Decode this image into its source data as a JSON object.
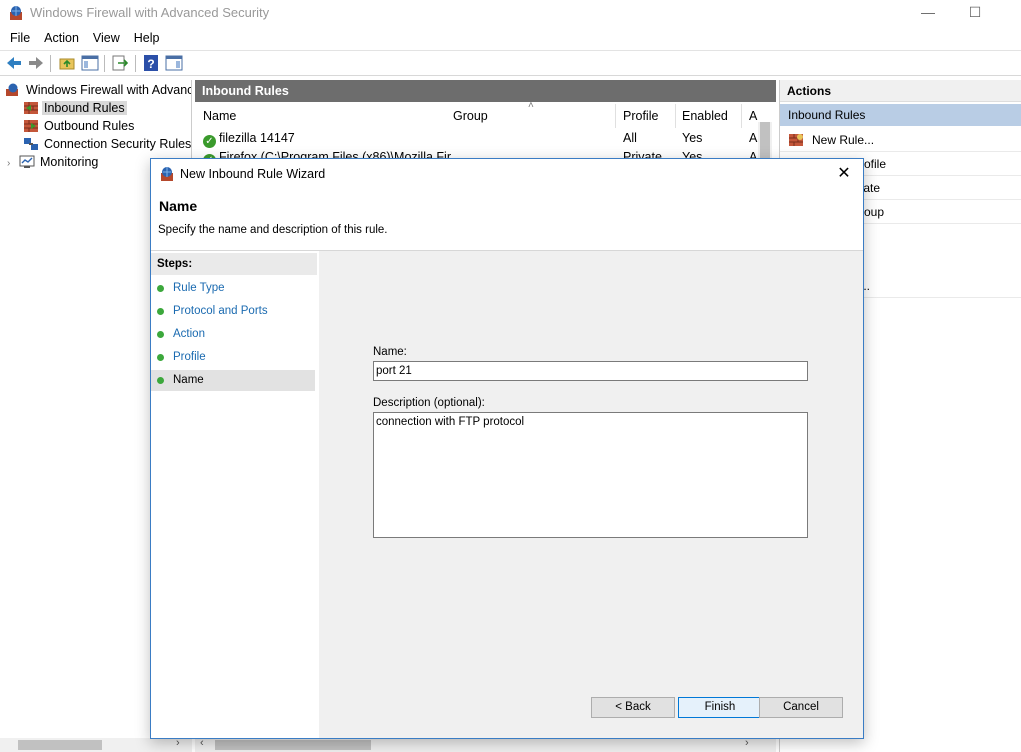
{
  "window": {
    "title": "Windows Firewall with Advanced Security",
    "controls": [
      "—",
      "☐",
      "✕"
    ]
  },
  "menu": [
    "File",
    "Action",
    "View",
    "Help"
  ],
  "tree": {
    "root": "Windows Firewall with Advance",
    "items": [
      "Inbound Rules",
      "Outbound Rules",
      "Connection Security Rules",
      "Monitoring"
    ],
    "selected": "Inbound Rules"
  },
  "center": {
    "header": "Inbound Rules",
    "columns": [
      "Name",
      "Group",
      "Profile",
      "Enabled",
      "A"
    ],
    "rows": [
      {
        "name": "filezilla 14147",
        "group": "",
        "profile": "All",
        "enabled": "Yes",
        "a": "A"
      },
      {
        "name": "Firefox (C:\\Program Files (x86)\\Mozilla Fir",
        "group": "",
        "profile": "Private",
        "enabled": "Yes",
        "a": "A"
      }
    ]
  },
  "actions": {
    "header": "Actions",
    "subheader": "Inbound Rules",
    "items": [
      "New Rule...",
      "rofile",
      "tate",
      "roup",
      "..."
    ]
  },
  "dialog": {
    "title": "New Inbound Rule Wizard",
    "heading": "Name",
    "subheading": "Specify the name and description of this rule.",
    "steps_label": "Steps:",
    "steps": [
      "Rule Type",
      "Protocol and Ports",
      "Action",
      "Profile",
      "Name"
    ],
    "current_step": "Name",
    "name_label": "Name:",
    "name_value": "port 21",
    "description_label": "Description (optional):",
    "description_value": "connection with FTP protocol",
    "buttons": {
      "back": "< Back",
      "finish": "Finish",
      "cancel": "Cancel"
    }
  },
  "colors": {
    "center_header_bg": "#6d6d6d",
    "actions_selected_bg": "#b9cde5",
    "step_dot": "#3ca83c",
    "link": "#1a6ab0",
    "dialog_border": "#3a7cc4"
  }
}
